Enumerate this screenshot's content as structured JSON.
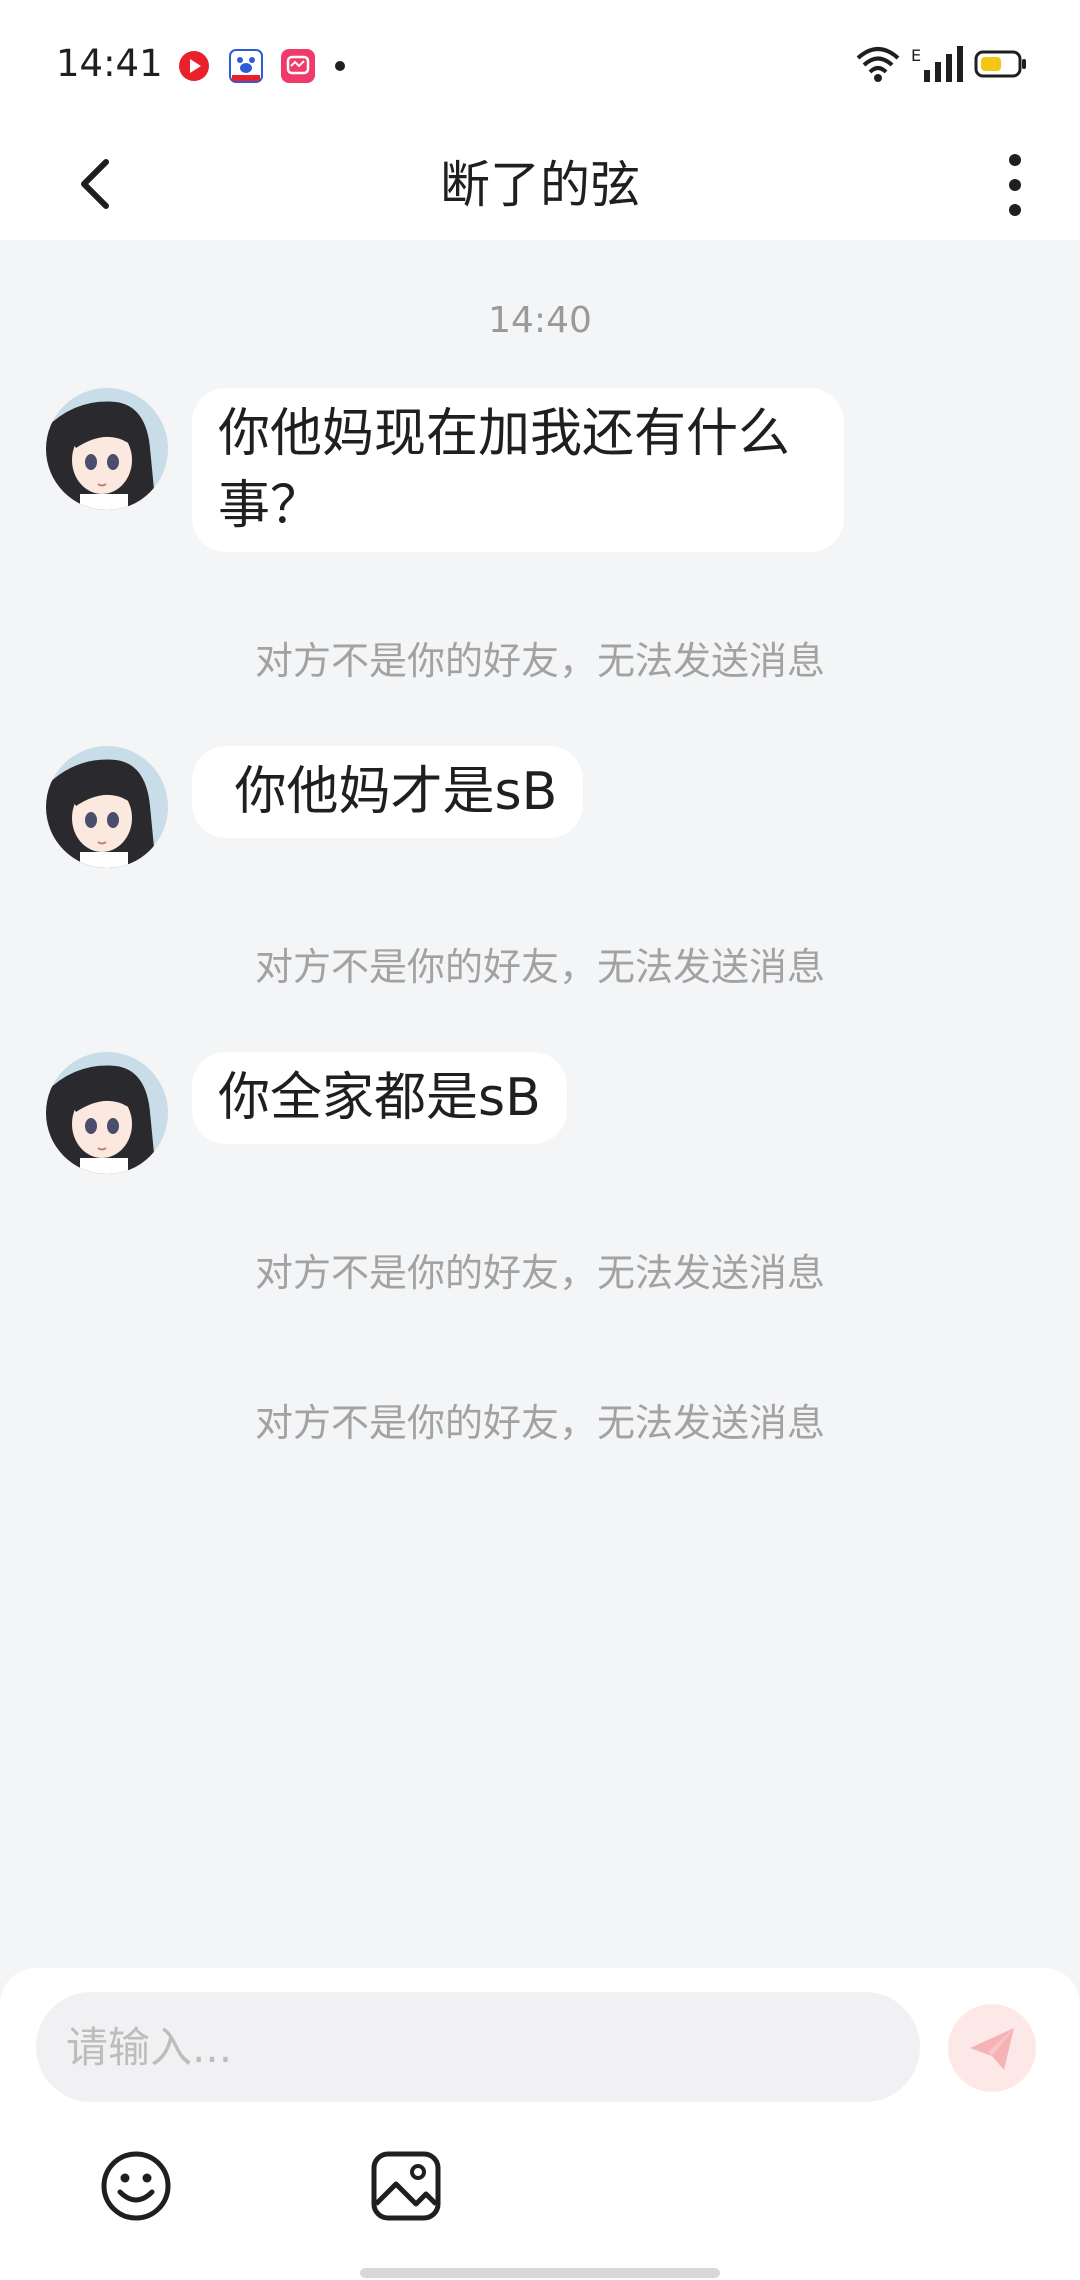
{
  "status_bar": {
    "time": "14:41",
    "notification_icons": [
      "video-app-icon",
      "baidu-app-icon",
      "photo-app-icon",
      "notification-dot"
    ],
    "network_label": "E",
    "battery_color": "#f5c518"
  },
  "header": {
    "title": "断了的弦",
    "back_icon": "chevron-left-icon",
    "menu_icon": "vertical-ellipsis-icon"
  },
  "chat": {
    "timestamp": "14:40",
    "messages": [
      {
        "text": "你他妈现在加我还有什么事？",
        "notice": "对方不是你的好友，无法发送消息"
      },
      {
        "text": " 你他妈才是sB",
        "notice": "对方不是你的好友，无法发送消息"
      },
      {
        "text": "你全家都是sB",
        "notice": "对方不是你的好友，无法发送消息"
      }
    ],
    "extra_notice": "对方不是你的好友，无法发送消息"
  },
  "composer": {
    "placeholder": "请输入...",
    "send_icon": "paper-plane-icon",
    "send_color": "#f08a8a",
    "tools": [
      "emoji-icon",
      "image-icon"
    ]
  }
}
